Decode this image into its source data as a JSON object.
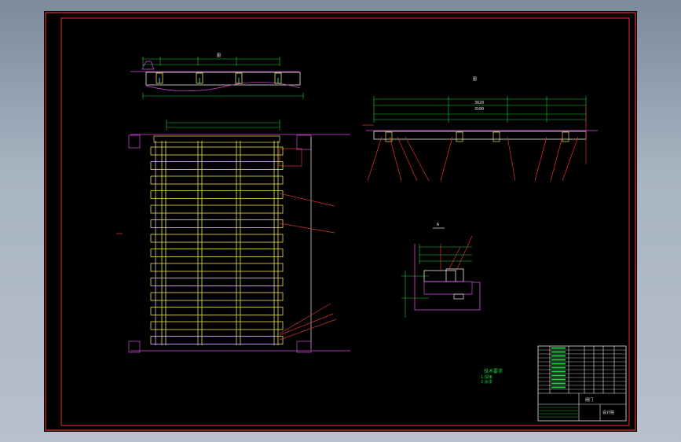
{
  "colors": {
    "background": "#000000",
    "frame": "#e0342f",
    "outline": "#e8e8e8",
    "member": "#e6e04a",
    "dimension": "#19d23c",
    "section": "#d54bd8",
    "callout": "#e0342f",
    "marker": "#39c8e8"
  },
  "views": {
    "top_detail": {
      "label": "图"
    },
    "side_elevation": {
      "total_dim": "3820",
      "sub_dim": "3500",
      "label": "图"
    },
    "section_detail": {
      "label": "A"
    }
  },
  "notes": {
    "title": "技术要求",
    "lines": [
      "1.焊接",
      "2.涂漆"
    ]
  },
  "title_block": {
    "drawing_name": "闸门",
    "company": "设计院"
  }
}
